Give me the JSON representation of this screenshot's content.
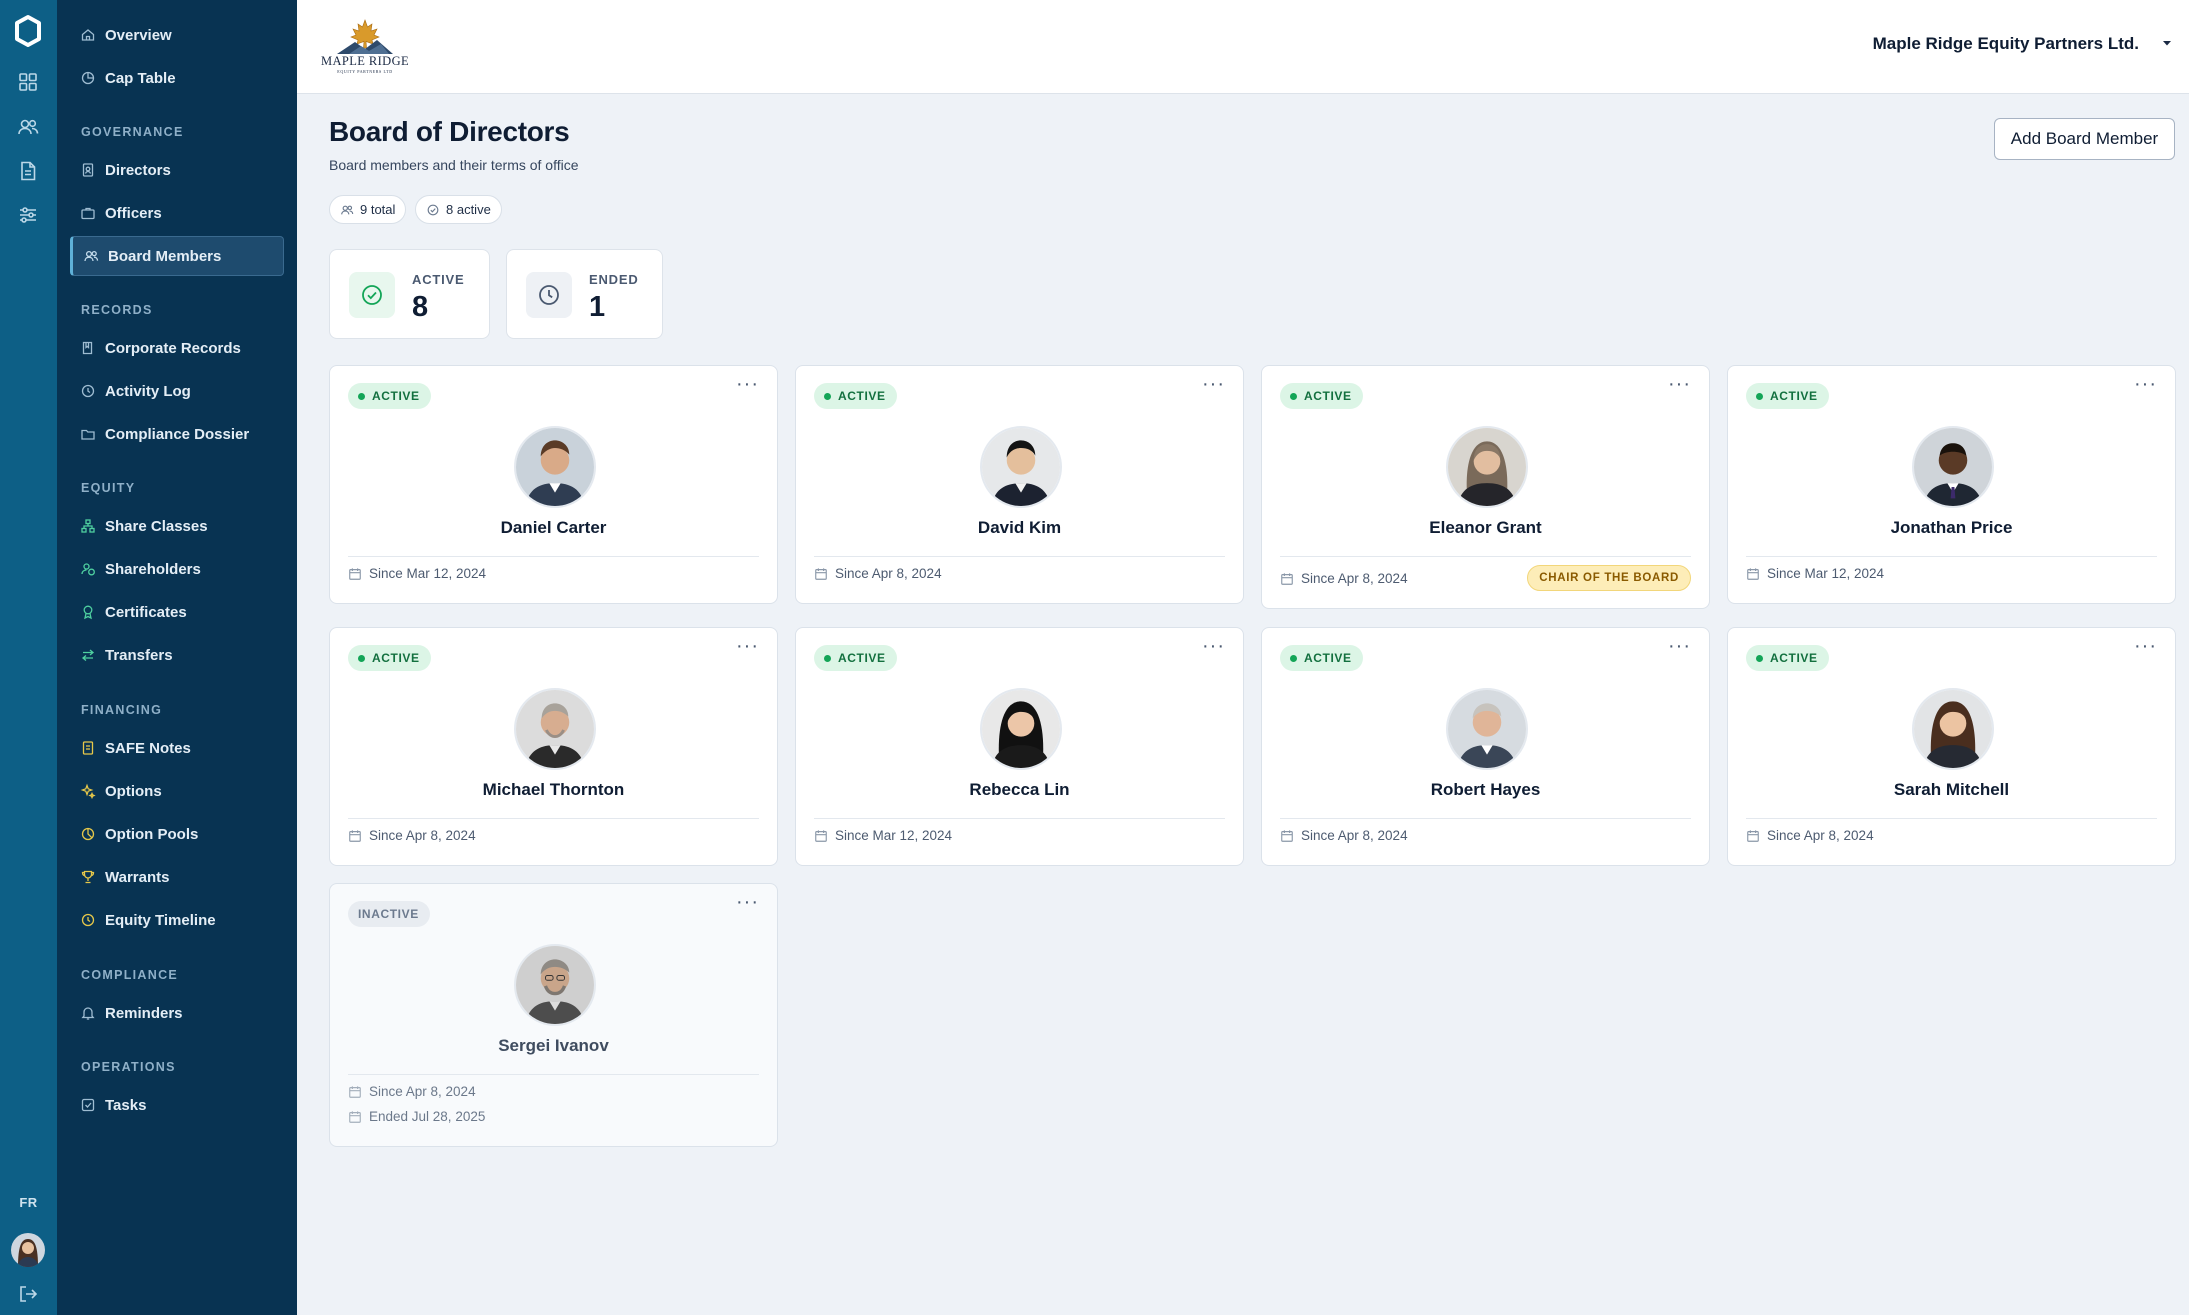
{
  "sidebar": {
    "items": [
      {
        "label": "Overview"
      },
      {
        "label": "Cap Table"
      },
      {
        "section": "GOVERNANCE"
      },
      {
        "label": "Directors"
      },
      {
        "label": "Officers"
      },
      {
        "label": "Board Members",
        "active": true
      },
      {
        "section": "RECORDS"
      },
      {
        "label": "Corporate Records"
      },
      {
        "label": "Activity Log"
      },
      {
        "label": "Compliance Dossier"
      },
      {
        "section": "EQUITY"
      },
      {
        "label": "Share Classes"
      },
      {
        "label": "Shareholders"
      },
      {
        "label": "Certificates"
      },
      {
        "label": "Transfers"
      },
      {
        "section": "FINANCING"
      },
      {
        "label": "SAFE Notes"
      },
      {
        "label": "Options"
      },
      {
        "label": "Option Pools"
      },
      {
        "label": "Warrants"
      },
      {
        "label": "Equity Timeline"
      },
      {
        "section": "COMPLIANCE"
      },
      {
        "label": "Reminders"
      },
      {
        "section": "OPERATIONS"
      },
      {
        "label": "Tasks"
      }
    ]
  },
  "rail": {
    "icons": [
      "app-logo-icon",
      "grid-icon",
      "users-icon",
      "document-icon",
      "sliders-icon",
      "logout-icon"
    ],
    "lang": "FR"
  },
  "header": {
    "brand_name": "MAPLE RIDGE",
    "brand_sub": "EQUITY PARTNERS LTD",
    "company": "Maple Ridge Equity Partners Ltd."
  },
  "page": {
    "title": "Board of Directors",
    "subtitle": "Board members and their terms of office",
    "chips": {
      "total": "9 total",
      "active": "8 active"
    },
    "add_button": "Add Board Member"
  },
  "stats": {
    "active": {
      "label": "ACTIVE",
      "value": "8"
    },
    "ended": {
      "label": "ENDED",
      "value": "1"
    }
  },
  "members": [
    {
      "name": "Daniel Carter",
      "status": "ACTIVE",
      "since": "Since Mar 12, 2024"
    },
    {
      "name": "David Kim",
      "status": "ACTIVE",
      "since": "Since Apr 8, 2024"
    },
    {
      "name": "Eleanor Grant",
      "status": "ACTIVE",
      "since": "Since Apr 8, 2024",
      "role": "CHAIR OF THE BOARD"
    },
    {
      "name": "Jonathan Price",
      "status": "ACTIVE",
      "since": "Since Mar 12, 2024"
    },
    {
      "name": "Michael Thornton",
      "status": "ACTIVE",
      "since": "Since Apr 8, 2024"
    },
    {
      "name": "Rebecca Lin",
      "status": "ACTIVE",
      "since": "Since Mar 12, 2024"
    },
    {
      "name": "Robert Hayes",
      "status": "ACTIVE",
      "since": "Since Apr 8, 2024"
    },
    {
      "name": "Sarah Mitchell",
      "status": "ACTIVE",
      "since": "Since Apr 8, 2024"
    },
    {
      "name": "Sergei Ivanov",
      "status": "INACTIVE",
      "since": "Since Apr 8, 2024",
      "ended": "Ended Jul 28, 2025"
    }
  ],
  "more_label": "···",
  "colors": {
    "rail": "#0d5f86",
    "sidebar": "#083352",
    "active_badge": "#dcf5e6",
    "active_text": "#13703f",
    "chair_badge": "#fdedb8"
  }
}
